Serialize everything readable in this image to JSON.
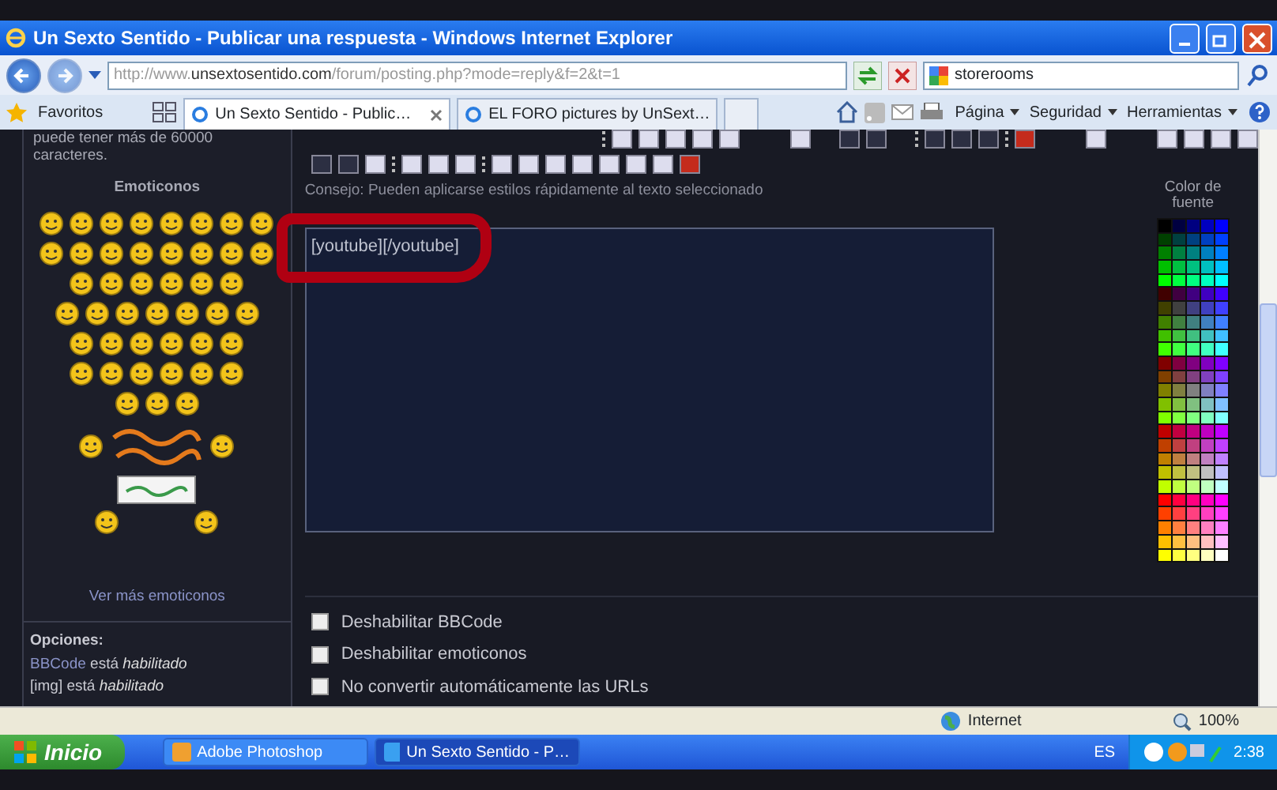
{
  "window": {
    "title": "Un Sexto Sentido - Publicar una respuesta - Windows Internet Explorer"
  },
  "nav": {
    "address_prefix": "http://www.",
    "address_domain": "unsextosentido.com",
    "address_path": "/forum/posting.php?mode=reply&f=2&t=1",
    "search_value": "storerooms"
  },
  "favorites_bar": {
    "favorites_label": "Favoritos",
    "tabs": [
      {
        "label": "Un Sexto Sentido - Public…",
        "selected": true
      },
      {
        "label": "EL FORO pictures by UnSext…",
        "selected": false
      }
    ],
    "commands": [
      "Página",
      "Seguridad",
      "Herramientas"
    ]
  },
  "sidebar": {
    "intro": "puede tener más de 60000 caracteres.",
    "emoticons_title": "Emoticonos",
    "more_link": "Ver más emoticonos",
    "options_title": "Opciones:",
    "options": [
      {
        "code": "BBCode",
        "linked": true,
        "rest": "está",
        "status": "habilitado"
      },
      {
        "code": "[img]",
        "linked": false,
        "rest": "está",
        "status": "habilitado"
      }
    ]
  },
  "editor": {
    "hint": "Consejo: Pueden aplicarse estilos rápidamente al texto seleccionado",
    "message": "[youtube][/youtube]",
    "font_color_label": "Color de fuente",
    "palette": [
      [
        {
          "color": "#000000"
        },
        {
          "color": "#000040"
        },
        {
          "color": "#000080"
        },
        {
          "color": "#0000c0"
        },
        {
          "color": "#0000ff"
        }
      ],
      [
        {
          "color": "#004000"
        },
        {
          "color": "#004040"
        },
        {
          "color": "#004080"
        },
        {
          "color": "#0040c0"
        },
        {
          "color": "#0040ff"
        }
      ],
      [
        {
          "color": "#008000"
        },
        {
          "color": "#008040"
        },
        {
          "color": "#008080"
        },
        {
          "color": "#0080c0"
        },
        {
          "color": "#0080ff"
        }
      ],
      [
        {
          "color": "#00c000"
        },
        {
          "color": "#00c040"
        },
        {
          "color": "#00c080"
        },
        {
          "color": "#00c0c0"
        },
        {
          "color": "#00c0ff"
        }
      ],
      [
        {
          "color": "#00ff00"
        },
        {
          "color": "#00ff40"
        },
        {
          "color": "#00ff80"
        },
        {
          "color": "#00ffc0"
        },
        {
          "color": "#00ffff"
        }
      ],
      [
        {
          "color": "#400000"
        },
        {
          "color": "#400040"
        },
        {
          "color": "#400080"
        },
        {
          "color": "#4000c0"
        },
        {
          "color": "#4000ff"
        }
      ],
      [
        {
          "color": "#404000"
        },
        {
          "color": "#404040"
        },
        {
          "color": "#404080"
        },
        {
          "color": "#4040c0"
        },
        {
          "color": "#4040ff"
        }
      ],
      [
        {
          "color": "#408000"
        },
        {
          "color": "#408040"
        },
        {
          "color": "#408080"
        },
        {
          "color": "#4080c0"
        },
        {
          "color": "#4080ff"
        }
      ],
      [
        {
          "color": "#40c000"
        },
        {
          "color": "#40c040"
        },
        {
          "color": "#40c080"
        },
        {
          "color": "#40c0c0"
        },
        {
          "color": "#40c0ff"
        }
      ],
      [
        {
          "color": "#40ff00"
        },
        {
          "color": "#40ff40"
        },
        {
          "color": "#40ff80"
        },
        {
          "color": "#40ffc0"
        },
        {
          "color": "#40ffff"
        }
      ],
      [
        {
          "color": "#800000"
        },
        {
          "color": "#800040"
        },
        {
          "color": "#800080"
        },
        {
          "color": "#8000c0"
        },
        {
          "color": "#8000ff"
        }
      ],
      [
        {
          "color": "#804000"
        },
        {
          "color": "#804040"
        },
        {
          "color": "#804080"
        },
        {
          "color": "#8040c0"
        },
        {
          "color": "#8040ff"
        }
      ],
      [
        {
          "color": "#808000"
        },
        {
          "color": "#808040"
        },
        {
          "color": "#808080"
        },
        {
          "color": "#8080c0"
        },
        {
          "color": "#8080ff"
        }
      ],
      [
        {
          "color": "#80c000"
        },
        {
          "color": "#80c040"
        },
        {
          "color": "#80c080"
        },
        {
          "color": "#80c0c0"
        },
        {
          "color": "#80c0ff"
        }
      ],
      [
        {
          "color": "#80ff00"
        },
        {
          "color": "#80ff40"
        },
        {
          "color": "#80ff80"
        },
        {
          "color": "#80ffc0"
        },
        {
          "color": "#80ffff"
        }
      ],
      [
        {
          "color": "#c00000"
        },
        {
          "color": "#c00040"
        },
        {
          "color": "#c00080"
        },
        {
          "color": "#c000c0"
        },
        {
          "color": "#c000ff"
        }
      ],
      [
        {
          "color": "#c04000"
        },
        {
          "color": "#c04040"
        },
        {
          "color": "#c04080"
        },
        {
          "color": "#c040c0"
        },
        {
          "color": "#c040ff"
        }
      ],
      [
        {
          "color": "#c08000"
        },
        {
          "color": "#c08040"
        },
        {
          "color": "#c08080"
        },
        {
          "color": "#c080c0"
        },
        {
          "color": "#c080ff"
        }
      ],
      [
        {
          "color": "#c0c000"
        },
        {
          "color": "#c0c040"
        },
        {
          "color": "#c0c080"
        },
        {
          "color": "#c0c0c0"
        },
        {
          "color": "#c0c0ff"
        }
      ],
      [
        {
          "color": "#c0ff00"
        },
        {
          "color": "#c0ff40"
        },
        {
          "color": "#c0ff80"
        },
        {
          "color": "#c0ffc0"
        },
        {
          "color": "#c0ffff"
        }
      ],
      [
        {
          "color": "#ff0000"
        },
        {
          "color": "#ff0040"
        },
        {
          "color": "#ff0080"
        },
        {
          "color": "#ff00c0"
        },
        {
          "color": "#ff00ff"
        }
      ],
      [
        {
          "color": "#ff4000"
        },
        {
          "color": "#ff4040"
        },
        {
          "color": "#ff4080"
        },
        {
          "color": "#ff40c0"
        },
        {
          "color": "#ff40ff"
        }
      ],
      [
        {
          "color": "#ff8000"
        },
        {
          "color": "#ff8040"
        },
        {
          "color": "#ff8080"
        },
        {
          "color": "#ff80c0"
        },
        {
          "color": "#ff80ff"
        }
      ],
      [
        {
          "color": "#ffc000"
        },
        {
          "color": "#ffc040"
        },
        {
          "color": "#ffc080"
        },
        {
          "color": "#ffc0c0"
        },
        {
          "color": "#ffc0ff"
        }
      ],
      [
        {
          "color": "#ffff00"
        },
        {
          "color": "#ffff40"
        },
        {
          "color": "#ffff80"
        },
        {
          "color": "#ffffc0"
        },
        {
          "color": "#ffffff"
        }
      ]
    ]
  },
  "checkboxes": [
    {
      "label": "Deshabilitar BBCode",
      "checked": false
    },
    {
      "label": "Deshabilitar emoticonos",
      "checked": false
    },
    {
      "label": "No convertir automáticamente las URLs",
      "checked": false
    }
  ],
  "status_bar": {
    "zone": "Internet",
    "zoom": "100%"
  },
  "taskbar": {
    "start": "Inicio",
    "tasks": [
      {
        "label": "Adobe Photoshop",
        "selected": false
      },
      {
        "label": "Un Sexto Sentido - P…",
        "selected": true
      }
    ],
    "language": "ES",
    "clock": "2:38"
  }
}
